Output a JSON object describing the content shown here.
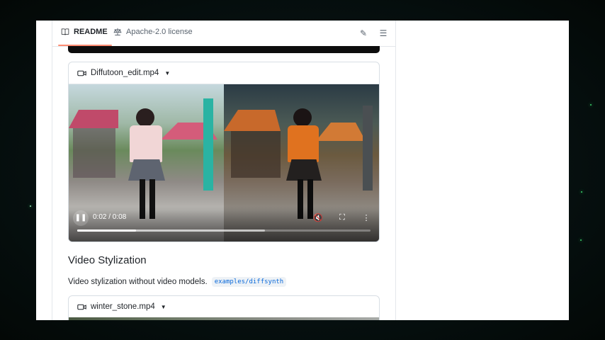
{
  "tabs": {
    "readme": "README",
    "license": "Apache-2.0 license"
  },
  "video1": {
    "filename": "Diffutoon_edit.mp4",
    "time": "0:02 / 0:08",
    "progress": 0.2,
    "buffered": 0.64
  },
  "section": {
    "title": "Video Stylization",
    "description": "Video stylization without video models.",
    "code": "examples/diffsynth"
  },
  "video2": {
    "filename": "winter_stone.mp4"
  },
  "colors": {
    "tab_underline": "#fd8c73",
    "link": "#0969da"
  }
}
